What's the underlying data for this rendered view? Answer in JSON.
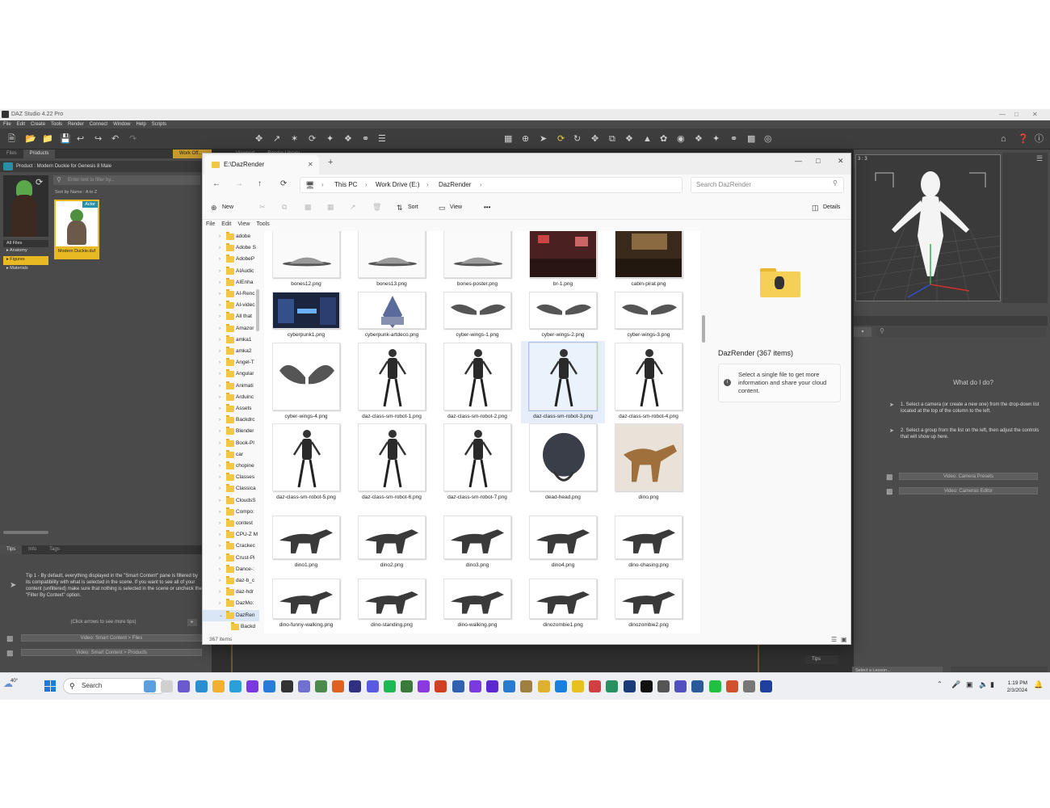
{
  "daz": {
    "title": "DAZ Studio 4.22 Pro",
    "menu": [
      "File",
      "Edit",
      "Create",
      "Tools",
      "Render",
      "Connect",
      "Window",
      "Help",
      "Scripts"
    ],
    "left_tabs": [
      "Files",
      "Products"
    ],
    "work_tab": "Work Off...",
    "product_label": "Product : Modern Duckie for Genesis 8 Male",
    "filter_placeholder": "Enter text to filter by...",
    "sort_label": "Sort by Name : A to Z",
    "categories": [
      "All Files",
      "Anatomy",
      "Figures",
      "Materials"
    ],
    "product_badge": "Actor",
    "product_name": "Modern Duckie.duf",
    "tips_tabs": [
      "Tips",
      "Info",
      "Tags"
    ],
    "tip_text": "Tip 1 - By default, everything displayed in the \"Smart Content\" pane is filtered by its compatibility with what is selected in the scene. If you want to see all of your content (unfiltered) make sure that nothing is selected in the scene or uncheck the \"Filter By Context\" option.",
    "tip_more": "(Click arrows to see more tips)",
    "left_videos": [
      "Video: Smart Content > Files",
      "Video: Smart Content > Products"
    ],
    "mid_tabs": [
      "Viewport",
      "Render Library"
    ],
    "viewport_label": "3 : 3",
    "what_do_i_do": "What do I do?",
    "instructions": [
      "1. Select a camera (or create a new one) from the drop-down list located at the top of the column to the left.",
      "2. Select a group from the list on the left, then adjust the controls that will show up here."
    ],
    "right_videos": [
      "Video: Camera Presets",
      "Video: Cameras Editor"
    ],
    "right_tips_tab": "Tips",
    "lesson_select": "Select a Lesson..."
  },
  "explorer": {
    "tab_title": "E:\\DazRender",
    "breadcrumb": [
      "This PC",
      "Work Drive (E:)",
      "DazRender"
    ],
    "search_placeholder": "Search DazRender",
    "commands": {
      "new": "New",
      "sort": "Sort",
      "view": "View",
      "more": "•••",
      "details": "Details"
    },
    "menu": [
      "File",
      "Edit",
      "View",
      "Tools"
    ],
    "tree": [
      "adobe",
      "Adobe S",
      "AdobeP",
      "AIAudic",
      "AIEnha",
      "AI-Renc",
      "AI-videc",
      "All that",
      "Amazor",
      "amka1",
      "amka2",
      "Angel-T",
      "Angular",
      "Animati",
      "Arduinc",
      "Assets",
      "Backdrc",
      "Blender",
      "Book-Pl",
      "car",
      "chopine",
      "Classes",
      "Classica",
      "CloudsS",
      "Compo:",
      "contest",
      "CPU-Z M",
      "Crackec",
      "Crust-Pi",
      "Dance-:",
      "daz-b_c",
      "daz-hdr",
      "DazMo:",
      "DazRen",
      "Backd"
    ],
    "selected_tree": "DazRen",
    "files": [
      "bones12.png",
      "bones13.png",
      "bones-poster.png",
      "br-1.png",
      "cabin-pirat.png",
      "cyberpunk1.png",
      "cyberpunk-artdeco.png",
      "cyber-wings-1.png",
      "cyber-wings-2.png",
      "cyber-wings-3.png",
      "cyber-wings-4.png",
      "daz-class-sm-robot-1.png",
      "daz-class-sm-robot-2.png",
      "daz-class-sm-robot-3.png",
      "daz-class-sm-robot-4.png",
      "daz-class-sm-robot-5.png",
      "daz-class-sm-robot-6.png",
      "daz-class-sm-robot-7.png",
      "dead-head.png",
      "dino.png",
      "dino1.png",
      "dino2.png",
      "dino3.png",
      "dino4.png",
      "dino-chasing.png",
      "dino-funny-walking.png",
      "dino-standing.png",
      "dino-walking.png",
      "dinozombie1.png",
      "dinozombie2.png"
    ],
    "selected_file": "daz-class-sm-robot-3.png",
    "details_title": "DazRender (367 items)",
    "details_info": "Select a single file to get more information and share your cloud content.",
    "status": "367 items"
  },
  "taskbar": {
    "weather": "40°",
    "search": "Search",
    "time": "1:19 PM",
    "date": "2/3/2024"
  }
}
